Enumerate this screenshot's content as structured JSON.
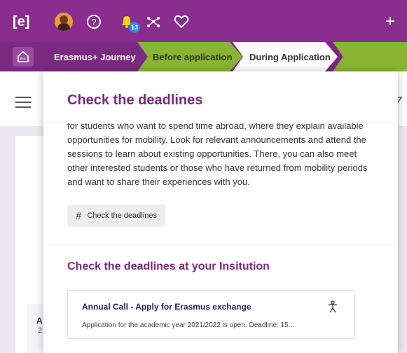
{
  "topbar": {
    "logo_icon": "e-plus-logo-icon",
    "help_icon": "question-circle-icon",
    "bell_icon": "bell-icon",
    "notification_count": "13",
    "network_icon": "network-icon",
    "heart_icon": "heart-icon",
    "add_icon": "plus-icon"
  },
  "journey": {
    "title": "Erasmus+ Journey",
    "steps": [
      "Before application",
      "During Application"
    ]
  },
  "background": {
    "card_letter": "A",
    "card_number": "2"
  },
  "modal": {
    "title": "Check the deadlines",
    "body": "for students who want to spend time abroad, where they explain available opportunities for mobility. Look for relevant announcements and attend the sessions to learn about existing opportunities. There, you can also meet other interested students or those who have returned from mobility periods and want to share their experiences with you.",
    "tag_label": "Check the deadlines",
    "section_title": "Check the deadlines at your Insitution",
    "call": {
      "title": "Annual Call - Apply for Erasmus exchange",
      "description": "Application for the academic year 2021/2022 is open. Deadline: 15..."
    }
  },
  "colors": {
    "purple": "#8a2d8f",
    "green": "#8ab534",
    "yellow": "#f0d21a"
  }
}
